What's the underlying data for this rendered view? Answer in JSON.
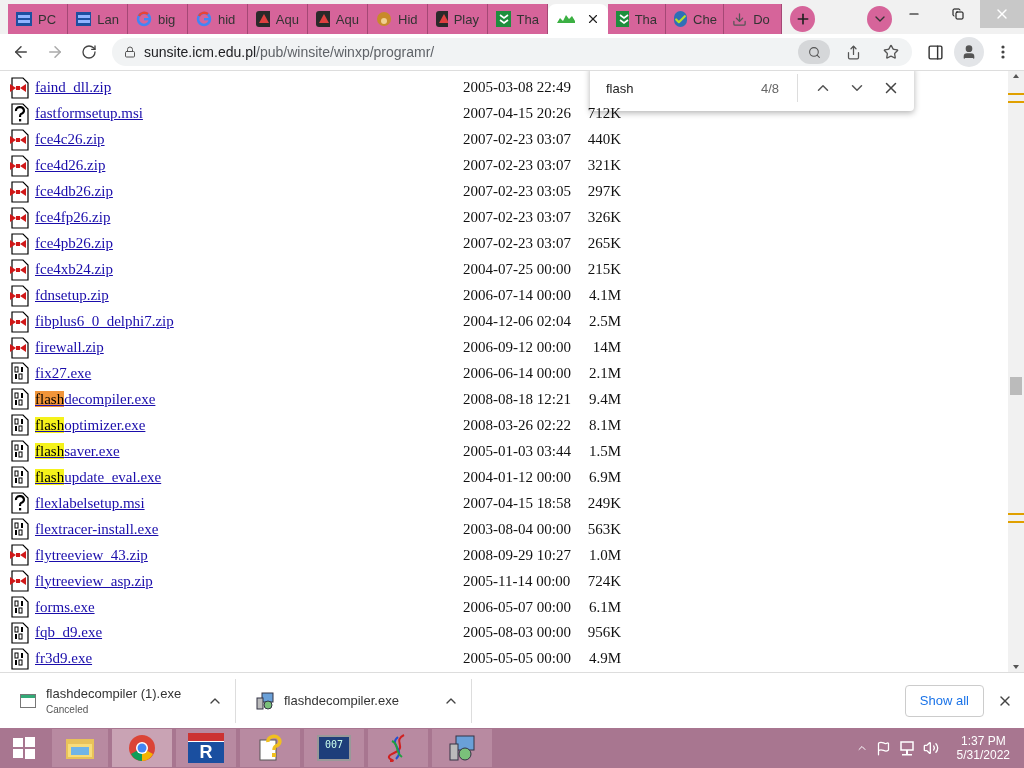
{
  "tabs": [
    {
      "label": "PC",
      "selected": false
    },
    {
      "label": "Lan",
      "selected": false
    },
    {
      "label": "big",
      "selected": false
    },
    {
      "label": "hid",
      "selected": false
    },
    {
      "label": "Aqu",
      "selected": false
    },
    {
      "label": "Aqu",
      "selected": false
    },
    {
      "label": "Hid",
      "selected": false
    },
    {
      "label": "Play",
      "selected": false
    },
    {
      "label": "Tha",
      "selected": false
    },
    {
      "selected": true
    },
    {
      "label": "Tha",
      "selected": false
    },
    {
      "label": "Che",
      "selected": false
    },
    {
      "label": "Do",
      "selected": false
    }
  ],
  "address": {
    "host": "sunsite.icm.edu.pl",
    "path": "/pub/winsite/winxp/programr/"
  },
  "find": {
    "query": "flash",
    "count": "4/8"
  },
  "files": [
    {
      "kind": "zip",
      "name": "faind_dll.zip",
      "date": "2005-03-08 22:49"
    },
    {
      "kind": "msi",
      "name": "fastformsetup.msi",
      "date": "2007-04-15 20:26",
      "size": "712K"
    },
    {
      "kind": "zip",
      "name": "fce4c26.zip",
      "date": "2007-02-23 03:07",
      "size": "440K"
    },
    {
      "kind": "zip",
      "name": "fce4d26.zip",
      "date": "2007-02-23 03:07",
      "size": "321K"
    },
    {
      "kind": "zip",
      "name": "fce4db26.zip",
      "date": "2007-02-23 03:05",
      "size": "297K"
    },
    {
      "kind": "zip",
      "name": "fce4fp26.zip",
      "date": "2007-02-23 03:07",
      "size": "326K"
    },
    {
      "kind": "zip",
      "name": "fce4pb26.zip",
      "date": "2007-02-23 03:07",
      "size": "265K"
    },
    {
      "kind": "zip",
      "name": "fce4xb24.zip",
      "date": "2004-07-25 00:00",
      "size": "215K"
    },
    {
      "kind": "zip",
      "name": "fdnsetup.zip",
      "date": "2006-07-14 00:00",
      "size": "4.1M"
    },
    {
      "kind": "zip",
      "name": "fibplus6_0_delphi7.zip",
      "date": "2004-12-06 02:04",
      "size": "2.5M"
    },
    {
      "kind": "zip",
      "name": "firewall.zip",
      "date": "2006-09-12 00:00",
      "size": "14M"
    },
    {
      "kind": "exe",
      "name": "fix27.exe",
      "date": "2006-06-14 00:00",
      "size": "2.1M"
    },
    {
      "kind": "exe",
      "match": "flash",
      "current": true,
      "name": "decompiler.exe",
      "date": "2008-08-18 12:21",
      "size": "9.4M"
    },
    {
      "kind": "exe",
      "match": "flash",
      "current": false,
      "name": "optimizer.exe",
      "date": "2008-03-26 02:22",
      "size": "8.1M"
    },
    {
      "kind": "exe",
      "match": "flash",
      "current": false,
      "name": "saver.exe",
      "date": "2005-01-03 03:44",
      "size": "1.5M"
    },
    {
      "kind": "exe",
      "match": "flash",
      "current": false,
      "name": "update_eval.exe",
      "date": "2004-01-12 00:00",
      "size": "6.9M"
    },
    {
      "kind": "msi",
      "name": "flexlabelsetup.msi",
      "date": "2007-04-15 18:58",
      "size": "249K"
    },
    {
      "kind": "exe",
      "name": "flextracer-install.exe",
      "date": "2003-08-04 00:00",
      "size": "563K"
    },
    {
      "kind": "zip",
      "name": "flytreeview_43.zip",
      "date": "2008-09-29 10:27",
      "size": "1.0M"
    },
    {
      "kind": "zip",
      "name": "flytreeview_asp.zip",
      "date": "2005-11-14 00:00",
      "size": "724K"
    },
    {
      "kind": "exe",
      "name": "forms.exe",
      "date": "2006-05-07 00:00",
      "size": "6.1M"
    },
    {
      "kind": "exe",
      "name": "fqb_d9.exe",
      "date": "2005-08-03 00:00",
      "size": "956K"
    },
    {
      "kind": "exe",
      "name": "fr3d9.exe",
      "date": "2005-05-05 00:00",
      "size": "4.9M"
    }
  ],
  "downloads": [
    {
      "name": "flashdecompiler (1).exe",
      "status": "Canceled"
    },
    {
      "name": "flashdecompiler.exe"
    }
  ],
  "downloads_button": "Show all",
  "taskbar": [
    {
      "selected": false
    },
    {
      "selected": true
    },
    {
      "label": "R",
      "selected": false
    },
    {
      "selected": false
    },
    {
      "label": "007",
      "selected": false
    },
    {
      "selected": false
    },
    {
      "selected": false
    }
  ],
  "clock": {
    "time": "1:37 PM",
    "date": "5/31/2022"
  }
}
